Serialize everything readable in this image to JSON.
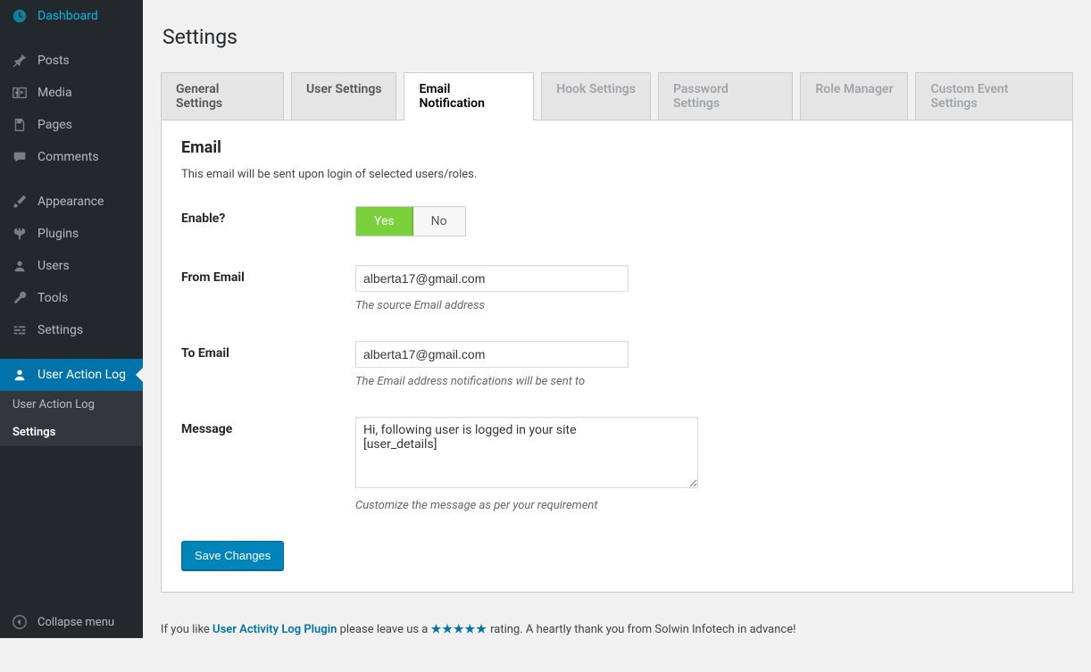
{
  "sidebar": {
    "items": [
      {
        "label": "Dashboard",
        "icon": "dashboard"
      },
      {
        "label": "Posts",
        "icon": "pin"
      },
      {
        "label": "Media",
        "icon": "media"
      },
      {
        "label": "Pages",
        "icon": "page"
      },
      {
        "label": "Comments",
        "icon": "comment"
      },
      {
        "label": "Appearance",
        "icon": "brush"
      },
      {
        "label": "Plugins",
        "icon": "plug"
      },
      {
        "label": "Users",
        "icon": "user"
      },
      {
        "label": "Tools",
        "icon": "wrench"
      },
      {
        "label": "Settings",
        "icon": "sliders"
      },
      {
        "label": "User Action Log",
        "icon": "user-log"
      }
    ],
    "submenu": [
      {
        "label": "User Action Log"
      },
      {
        "label": "Settings"
      }
    ],
    "collapse": "Collapse menu"
  },
  "page": {
    "title": "Settings"
  },
  "tabs": [
    {
      "label": "General Settings",
      "state": "normal"
    },
    {
      "label": "User Settings",
      "state": "normal"
    },
    {
      "label": "Email Notification",
      "state": "active"
    },
    {
      "label": "Hook Settings",
      "state": "disabled"
    },
    {
      "label": "Password Settings",
      "state": "disabled"
    },
    {
      "label": "Role Manager",
      "state": "disabled"
    },
    {
      "label": "Custom Event Settings",
      "state": "disabled"
    }
  ],
  "panel": {
    "heading": "Email",
    "description": "This email will be sent upon login of selected users/roles.",
    "fields": {
      "enable": {
        "label": "Enable?",
        "yes": "Yes",
        "no": "No",
        "value": "yes"
      },
      "from_email": {
        "label": "From Email",
        "value": "alberta17@gmail.com",
        "hint": "The source Email address"
      },
      "to_email": {
        "label": "To Email",
        "value": "alberta17@gmail.com",
        "hint": "The Email address notifications will be sent to"
      },
      "message": {
        "label": "Message",
        "value": "Hi, following user is logged in your site\n[user_details]",
        "hint": "Customize the message as per your requirement"
      }
    },
    "save": "Save Changes"
  },
  "footer": {
    "prefix": "If you like ",
    "link": "User Activity Log Plugin",
    "mid": " please leave us a ",
    "stars": "★★★★★",
    "suffix": " rating. A heartly thank you from Solwin Infotech in advance!"
  }
}
